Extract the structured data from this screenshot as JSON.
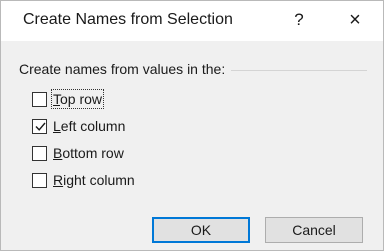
{
  "dialog": {
    "title": "Create Names from Selection",
    "help_label": "?",
    "close_label": "×"
  },
  "group": {
    "label": "Create names from values in the:"
  },
  "options": [
    {
      "mnemonic": "T",
      "rest": "op row",
      "checked": false
    },
    {
      "mnemonic": "L",
      "rest": "eft column",
      "checked": true
    },
    {
      "mnemonic": "B",
      "rest": "ottom row",
      "checked": false
    },
    {
      "mnemonic": "R",
      "rest": "ight column",
      "checked": false
    }
  ],
  "buttons": {
    "ok_label": "OK",
    "cancel_label": "Cancel"
  }
}
